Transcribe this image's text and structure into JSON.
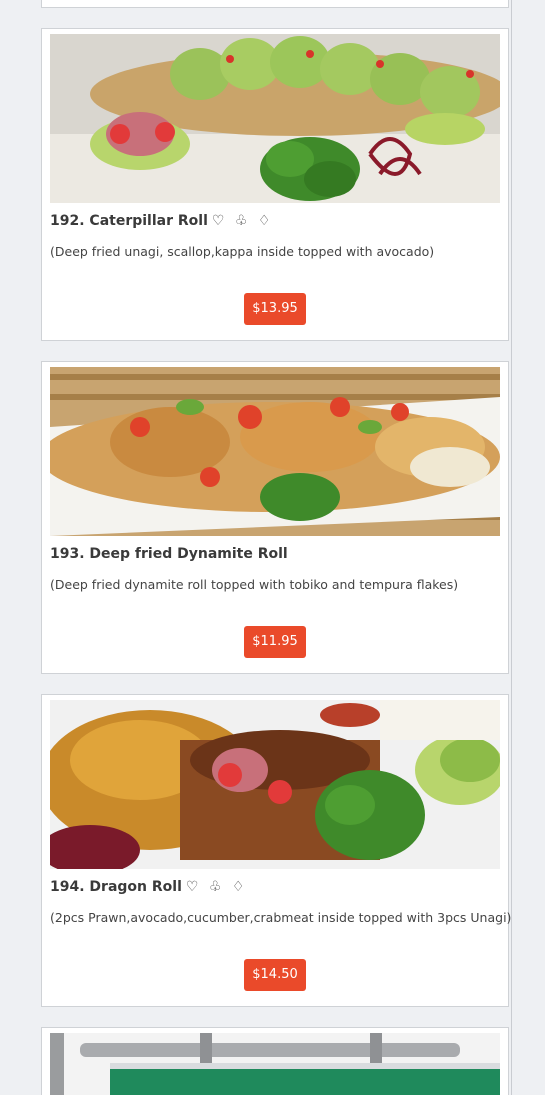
{
  "items": [
    {
      "title": "192. Caterpillar Roll",
      "symbols": "♡ ♧ ♢",
      "description": "(Deep fried unagi, scallop,kappa inside topped with avocado)",
      "price": "$13.95",
      "image_icon": "sushi-photo-icon"
    },
    {
      "title": "193. Deep fried Dynamite Roll",
      "symbols": "",
      "description": "(Deep fried dynamite roll topped with tobiko and tempura flakes)",
      "price": "$11.95",
      "image_icon": "sushi-photo-icon"
    },
    {
      "title": "194. Dragon Roll",
      "symbols": "♡ ♧ ♢",
      "description": "(2pcs Prawn,avocado,cucumber,crabmeat inside topped with 3pcs Unagi)",
      "price": "$14.50",
      "image_icon": "sushi-photo-icon"
    }
  ],
  "colors": {
    "page_background": "#eef0f3",
    "price_button": "#ea4a2a",
    "card_border": "#cfd2d6"
  }
}
